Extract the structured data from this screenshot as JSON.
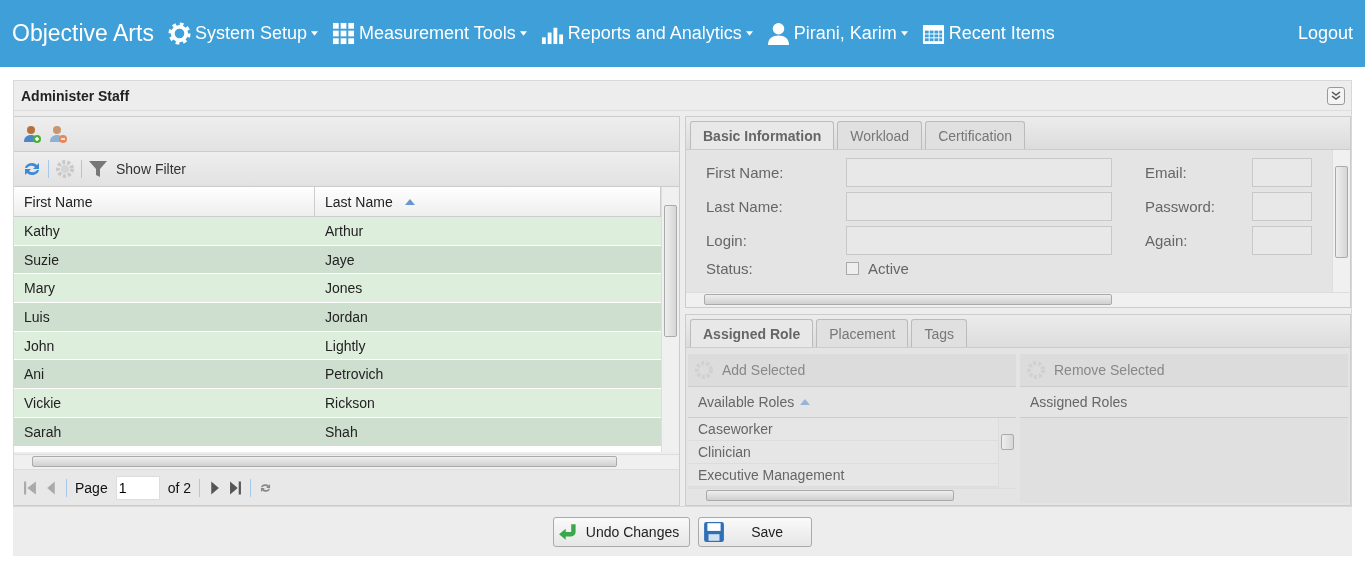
{
  "nav": {
    "brand": "Objective Arts",
    "menus": [
      {
        "label": "System Setup",
        "dropdown": true
      },
      {
        "label": "Measurement Tools",
        "dropdown": true
      },
      {
        "label": "Reports and Analytics",
        "dropdown": true
      },
      {
        "label": "Pirani, Karim",
        "dropdown": true
      },
      {
        "label": "Recent Items",
        "dropdown": false
      }
    ],
    "logout": "Logout"
  },
  "panel": {
    "title": "Administer Staff"
  },
  "staff_grid": {
    "filter_label": "Show Filter",
    "columns": [
      {
        "label": "First Name",
        "sorted": false
      },
      {
        "label": "Last Name",
        "sorted": true
      }
    ],
    "rows": [
      [
        "Kathy",
        "Arthur"
      ],
      [
        "Suzie",
        "Jaye"
      ],
      [
        "Mary",
        "Jones"
      ],
      [
        "Luis",
        "Jordan"
      ],
      [
        "John",
        "Lightly"
      ],
      [
        "Ani",
        "Petrovich"
      ],
      [
        "Vickie",
        "Rickson"
      ],
      [
        "Sarah",
        "Shah"
      ]
    ],
    "pager": {
      "page_label": "Page",
      "page_value": "1",
      "of_label": "of 2"
    }
  },
  "details": {
    "tabs": [
      {
        "label": "Basic Information",
        "selected": true
      },
      {
        "label": "Workload",
        "selected": false
      },
      {
        "label": "Certification",
        "selected": false
      }
    ],
    "fields_left": [
      {
        "label": "First Name:"
      },
      {
        "label": "Last Name:"
      },
      {
        "label": "Login:"
      }
    ],
    "fields_right": [
      {
        "label": "Email:"
      },
      {
        "label": "Password:"
      },
      {
        "label": "Again:"
      }
    ],
    "status": {
      "label": "Status:",
      "option": "Active",
      "checked": false
    }
  },
  "roles": {
    "tabs": [
      {
        "label": "Assigned Role",
        "selected": true
      },
      {
        "label": "Placement",
        "selected": false
      },
      {
        "label": "Tags",
        "selected": false
      }
    ],
    "add_button": "Add Selected",
    "remove_button": "Remove Selected",
    "available": {
      "column": "Available Roles",
      "items": [
        "Caseworker",
        "Clinician",
        "Executive Management"
      ]
    },
    "assigned": {
      "column": "Assigned Roles"
    }
  },
  "buttons": [
    {
      "label": "Undo Changes",
      "kind": "undo"
    },
    {
      "label": "Save",
      "kind": "save"
    }
  ]
}
